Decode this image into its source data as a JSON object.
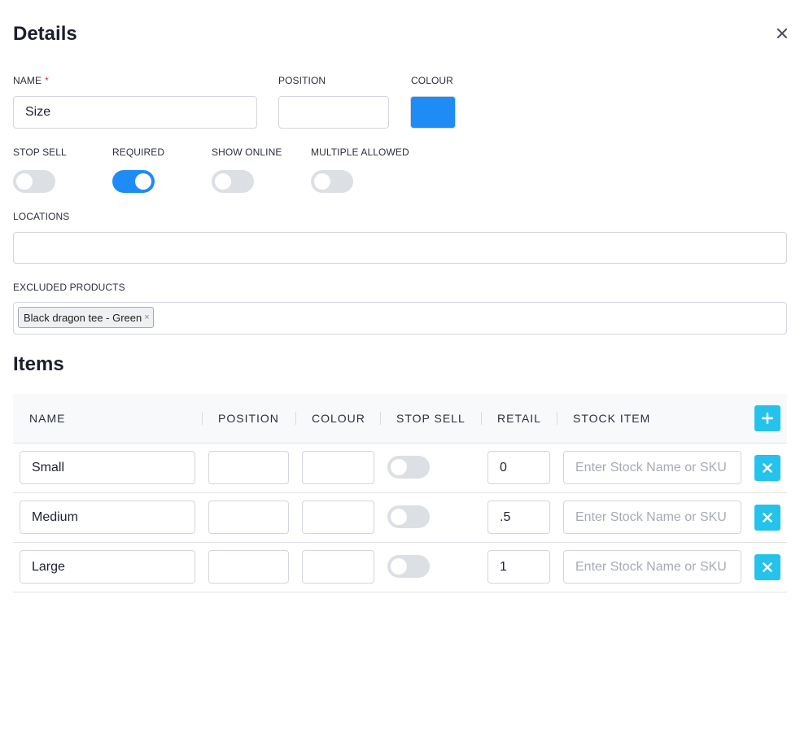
{
  "panel": {
    "title": "Details"
  },
  "form": {
    "name_label": "NAME",
    "required_mark": "*",
    "name_value": "Size",
    "position_label": "POSITION",
    "position_value": "",
    "colour_label": "COLOUR",
    "colour_value": "#1e8cf4",
    "toggles": {
      "stop_sell": {
        "label": "STOP SELL",
        "on": false
      },
      "required": {
        "label": "REQUIRED",
        "on": true
      },
      "show_online": {
        "label": "SHOW ONLINE",
        "on": false
      },
      "multiple_allowed": {
        "label": "MULTIPLE ALLOWED",
        "on": false
      }
    },
    "locations_label": "LOCATIONS",
    "locations_value": "",
    "excluded_label": "EXCLUDED PRODUCTS",
    "excluded_tags": [
      "Black dragon tee - Green"
    ],
    "tag_remove_glyph": "×"
  },
  "items": {
    "title": "Items",
    "columns": [
      "NAME",
      "POSITION",
      "COLOUR",
      "STOP SELL",
      "RETAIL",
      "STOCK ITEM"
    ],
    "stock_placeholder": "Enter Stock Name or SKU",
    "rows": [
      {
        "name": "Small",
        "position": "",
        "colour": "",
        "stop_sell": false,
        "retail": "0",
        "stock": ""
      },
      {
        "name": "Medium",
        "position": "",
        "colour": "",
        "stop_sell": false,
        "retail": ".5",
        "stock": ""
      },
      {
        "name": "Large",
        "position": "",
        "colour": "",
        "stop_sell": false,
        "retail": "1",
        "stock": ""
      }
    ]
  },
  "colors": {
    "accent": "#1e8cf4",
    "action": "#25c2ec",
    "required": "#e0314b"
  },
  "icons": {
    "close": "close-icon",
    "add": "plus-icon",
    "remove": "x-icon"
  }
}
